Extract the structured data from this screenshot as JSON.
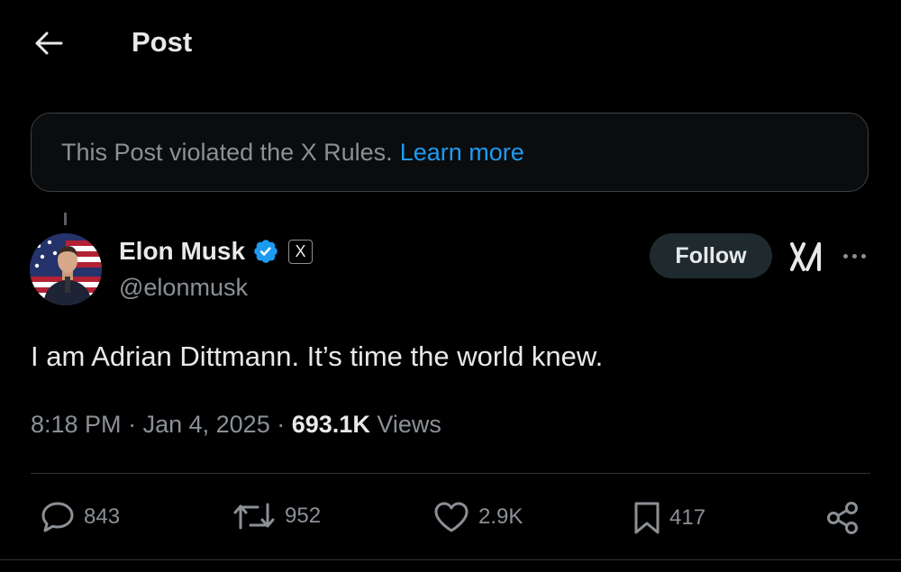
{
  "header": {
    "title": "Post",
    "back_icon": "arrow-left-icon"
  },
  "notice": {
    "text": "This Post violated the X Rules.",
    "link": "Learn more",
    "link_color": "#1d9bf0"
  },
  "author": {
    "name": "Elon Musk",
    "handle": "@elonmusk",
    "verified_icon": "verified-badge-icon",
    "affiliate_badge": "X",
    "avatar_icon": "profile-avatar"
  },
  "follow_button": {
    "label": "Follow"
  },
  "post": {
    "text": "I am Adrian Dittmann. It’s time the world knew."
  },
  "meta": {
    "time": "8:18 PM",
    "sep": "·",
    "date": "Jan 4, 2025",
    "views_count": "693.1K",
    "views_label": "Views"
  },
  "actions": {
    "replies": "843",
    "reposts": "952",
    "likes": "2.9K",
    "bookmarks": "417"
  },
  "colors": {
    "background": "#000000",
    "text": "#e7e9ea",
    "muted": "#8b9096",
    "accent": "#1d9bf0",
    "follow_bg": "#1e2a2d"
  }
}
